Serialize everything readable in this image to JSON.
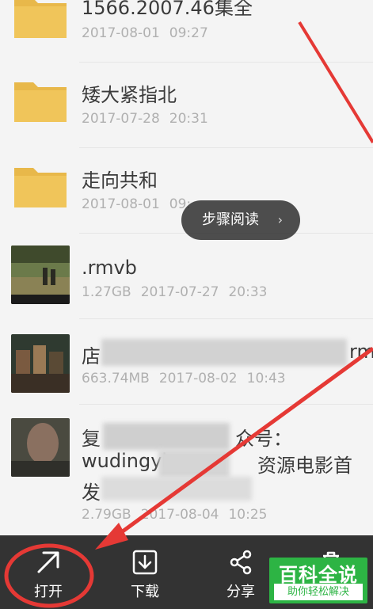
{
  "files": [
    {
      "name": "1566.2007.46集全",
      "date": "2017-08-01",
      "time": "09:27",
      "type": "folder"
    },
    {
      "name": "矮大紧指北",
      "date": "2017-07-28",
      "time": "20:31",
      "type": "folder"
    },
    {
      "name": "走向共和",
      "date": "2017-08-01",
      "time": "09:",
      "type": "folder"
    },
    {
      "name": ".rmvb",
      "size": "1.27GB",
      "date": "2017-07-27",
      "time": "20:33",
      "type": "video"
    },
    {
      "name_start": "店",
      "name_end": "rm",
      "size": "663.74MB",
      "date": "2017-08-02",
      "time": "10:43",
      "type": "video"
    },
    {
      "name_line1_start": "复",
      "name_line1_end": "众号：",
      "name_line2_start": "wudingyin",
      "name_line2_end": "资源电影首",
      "name_line3": "发",
      "size": "2.79GB",
      "date": "2017-08-04",
      "time": "10:25",
      "type": "video"
    }
  ],
  "popup": {
    "label": "步骤阅读",
    "chevron": "›"
  },
  "toolbar": {
    "open": {
      "label": "打开",
      "icon": "arrow-up-right-icon"
    },
    "download": {
      "label": "下载",
      "icon": "download-icon"
    },
    "share": {
      "label": "分享",
      "icon": "share-icon"
    }
  },
  "watermark": {
    "title": "百科全说",
    "subtitle": "助你轻松解决"
  },
  "colors": {
    "folder": "#e8b84a",
    "toolbar": "#333333",
    "annotation": "#e53935",
    "watermark": "#2db444"
  }
}
